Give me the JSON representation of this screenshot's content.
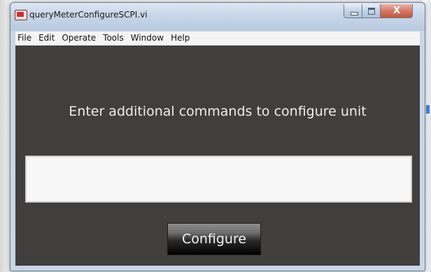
{
  "window": {
    "title": "queryMeterConfigureSCPI.vi",
    "icon": "labview-vi-icon",
    "controls": {
      "minimize_icon": "minimize-icon",
      "maximize_icon": "maximize-icon",
      "close_label": "X"
    }
  },
  "menu": {
    "items": [
      "File",
      "Edit",
      "Operate",
      "Tools",
      "Window",
      "Help"
    ]
  },
  "panel": {
    "instruction": "Enter additional commands to configure unit",
    "command_input": {
      "value": "",
      "placeholder": ""
    },
    "configure_button": "Configure"
  },
  "colors": {
    "panel_background": "#403f3e",
    "input_background": "#f7f7f7",
    "close_button": "#c4553c",
    "title_bar": "#c7d6e8"
  }
}
